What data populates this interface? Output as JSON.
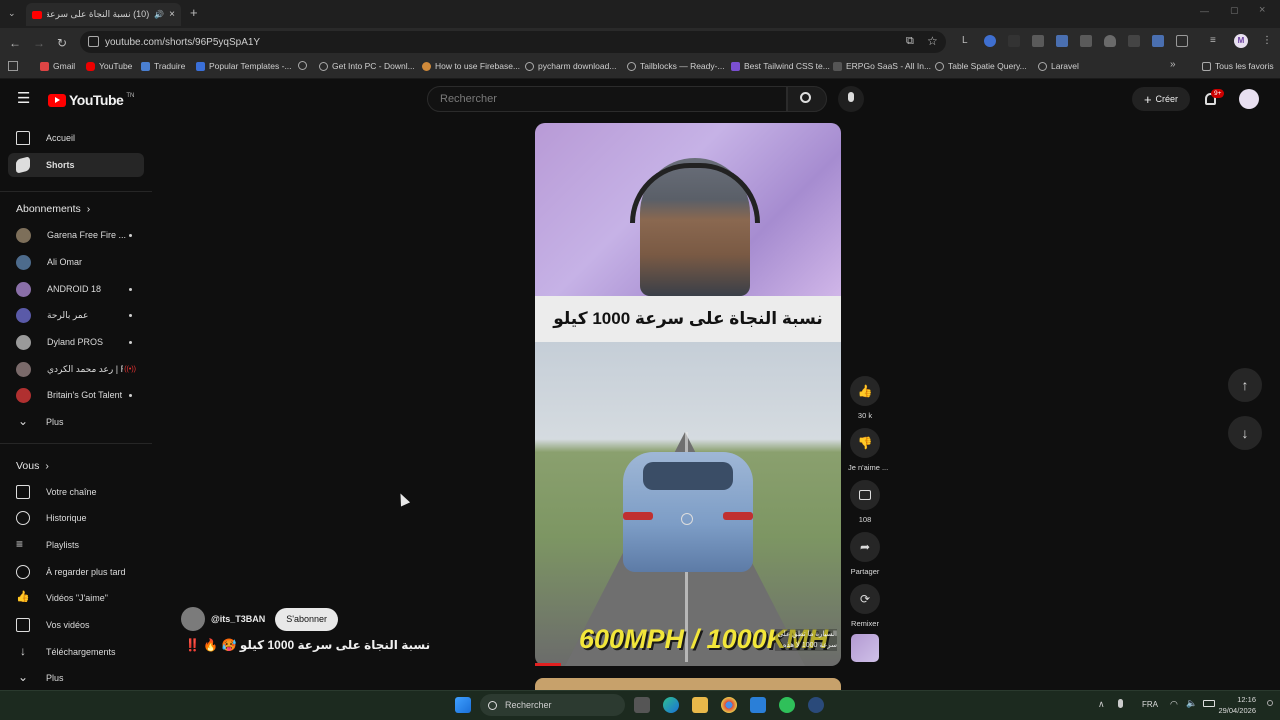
{
  "browser": {
    "tab_title": "(10) نسبة النجاة على سرعة 0",
    "url": "youtube.com/shorts/96P5yqSpA1Y",
    "bookmarks": [
      "Gmail",
      "YouTube",
      "Traduire",
      "Popular Templates -...",
      "Get Into PC - Downl...",
      "How to use Firebase...",
      "pycharm download...",
      "Tailblocks — Ready-...",
      "Best Tailwind CSS te...",
      "ERPGo SaaS - All In...",
      "Table Spatie Query...",
      "Laravel"
    ],
    "all_bookmarks": "Tous les favoris",
    "profile_initial": "M"
  },
  "header": {
    "logo_text": "YouTube",
    "logo_sup": "TN",
    "search_placeholder": "Rechercher",
    "create_label": "Créer",
    "notif_count": "9+"
  },
  "sidebar": {
    "home": "Accueil",
    "shorts": "Shorts",
    "subscriptions_title": "Abonnements",
    "subscriptions": [
      {
        "name": "Garena Free Fire ...",
        "color": "#7d6f5a",
        "live": "dot"
      },
      {
        "name": "Ali Omar",
        "color": "#4d6b8c",
        "live": ""
      },
      {
        "name": "ANDROID 18",
        "color": "#8a6fa8",
        "live": "dot"
      },
      {
        "name": "عمر بالرحة",
        "color": "#5a5aa8",
        "live": "dot"
      },
      {
        "name": "Dyland PROS",
        "color": "#9a9a9a",
        "live": "dot"
      },
      {
        "name": "رعد محمد الكردي | R...",
        "color": "#7a6a6a",
        "live": "live"
      },
      {
        "name": "Britain's Got Talent",
        "color": "#b03030",
        "live": "dot"
      }
    ],
    "more": "Plus",
    "you_title": "Vous",
    "you_items": [
      "Votre chaîne",
      "Historique",
      "Playlists",
      "À regarder plus tard",
      "Vidéos \"J'aime\"",
      "Vos vidéos",
      "Téléchargements",
      "Plus"
    ]
  },
  "video": {
    "title_overlay": "نسبة النجاة على سرعة 1000 كيلو",
    "speed_text": "600MPH / 1000KMH",
    "caption_overlay": "السيارة ما تطق على سرعة 1000 لا هذه",
    "progress_fraction": 0.085
  },
  "actions": {
    "likes": "30 k",
    "dislike": "Je n'aime ...",
    "comments": "108",
    "share": "Partager",
    "remix": "Remixer"
  },
  "channel": {
    "handle": "@its_T3BAN",
    "subscribe": "S'abonner",
    "short_title": "‼️ 🔥 🥵 نسبة النجاة على سرعة 1000 كيلو"
  },
  "taskbar": {
    "search": "Rechercher",
    "lang": "FRA",
    "time": "12:16",
    "date": "29/04/2026"
  }
}
